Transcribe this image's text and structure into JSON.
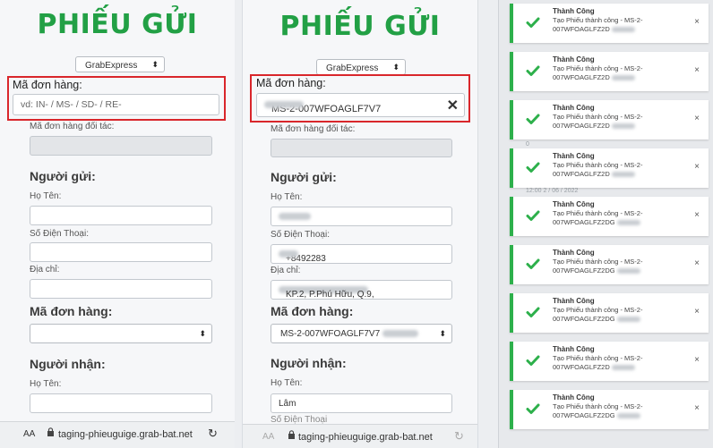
{
  "form_left": {
    "title": "PHIẾU GỬI",
    "service": "GrabExpress",
    "order_code_label": "Mã đơn hàng:",
    "order_code_placeholder": "vd: IN- / MS- / SD- / RE-",
    "partner_code_label": "Mã đơn hàng đối tác:",
    "sender_heading": "Người gửi:",
    "name_label": "Họ Tên:",
    "phone_label": "Số Điện Thoại:",
    "address_label": "Địa chỉ:",
    "order_select_heading": "Mã đơn hàng:",
    "receiver_heading": "Người nhận:",
    "receiver_name_label": "Họ Tên:",
    "url": "taging-phieuguige.grab-bat.net",
    "text_size": "AA"
  },
  "form_right": {
    "title": "PHIẾU GỬI",
    "service": "GrabExpress",
    "order_code_label": "Mã đơn hàng:",
    "order_code_value": "MS-2-007WFOAGLF7V7",
    "partner_code_label": "Mã đơn hàng đối tác:",
    "sender_heading": "Người gửi:",
    "name_label": "Họ Tên:",
    "phone_label": "Số Điện Thoại:",
    "phone_value": "+8492283",
    "address_label": "Địa chỉ:",
    "address_value": "KP.2, P.Phú Hữu, Q.9,",
    "order_select_heading": "Mã đơn hàng:",
    "order_select_value": "MS-2-007WFOAGLF7V7",
    "receiver_heading": "Người nhận:",
    "receiver_name_label": "Họ Tên:",
    "receiver_name_value": "Lâm",
    "phone_label_cut": "Số Điện Thoại",
    "url": "taging-phieuguige.grab-bat.net",
    "text_size": "AA"
  },
  "toasts": [
    {
      "title": "Thành Công",
      "line1": "Tạo Phiếu thành công - MS-2-",
      "line2": "007WFOAGLFZ2D"
    },
    {
      "title": "Thành Công",
      "line1": "Tạo Phiếu thành công - MS-2-",
      "line2": "007WFOAGLFZ2D"
    },
    {
      "title": "Thành Công",
      "line1": "Tạo Phiếu thành công - MS-2-",
      "line2": "007WFOAGLFZ2D"
    },
    {
      "title": "Thành Công",
      "line1": "Tạo Phiếu thành công - MS-2-",
      "line2": "007WFOAGLFZ2D"
    },
    {
      "title": "Thành Công",
      "line1": "Tạo Phiếu thành công - MS-2-",
      "line2": "007WFOAGLFZ2DG"
    },
    {
      "title": "Thành Công",
      "line1": "Tạo Phiếu thành công - MS-2-",
      "line2": "007WFOAGLFZ2DG"
    },
    {
      "title": "Thành Công",
      "line1": "Tạo Phiếu thành công - MS-2-",
      "line2": "007WFOAGLFZ2DG"
    },
    {
      "title": "Thành Công",
      "line1": "Tạo Phiếu thành công - MS-2-",
      "line2": "007WFOAGLFZ2D"
    },
    {
      "title": "Thành Công",
      "line1": "Tạo Phiếu thành công - MS-2-",
      "line2": "007WFOAGLFZ2DG"
    }
  ],
  "close_glyph": "×",
  "colors": {
    "brand_green": "#22a045",
    "highlight_red": "#d9262b",
    "toast_accent": "#2db04b"
  }
}
